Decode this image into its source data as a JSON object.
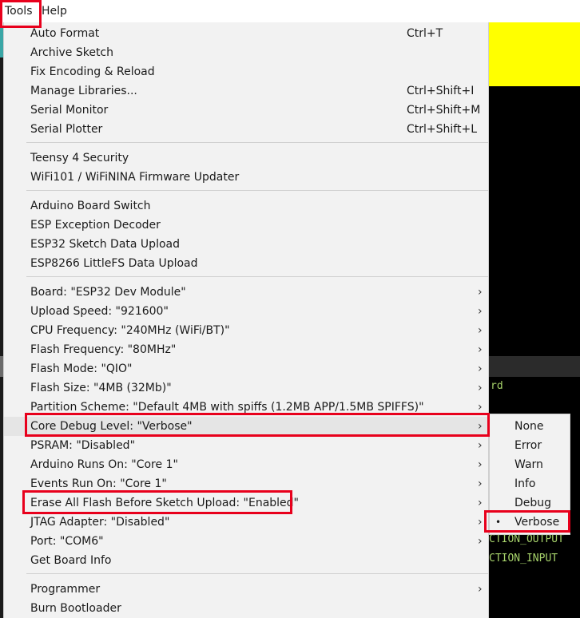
{
  "menubar": {
    "tools": "Tools",
    "help": "Help"
  },
  "console": {
    "line1": "rd",
    "line2": "CTION_OUTPUT",
    "line3": "CTION_INPUT"
  },
  "tools_menu": {
    "g1": [
      {
        "label": "Auto Format",
        "shortcut": "Ctrl+T"
      },
      {
        "label": "Archive Sketch"
      },
      {
        "label": "Fix Encoding & Reload"
      },
      {
        "label": "Manage Libraries...",
        "shortcut": "Ctrl+Shift+I"
      },
      {
        "label": "Serial Monitor",
        "shortcut": "Ctrl+Shift+M"
      },
      {
        "label": "Serial Plotter",
        "shortcut": "Ctrl+Shift+L"
      }
    ],
    "g2": [
      {
        "label": "Teensy 4 Security"
      },
      {
        "label": "WiFi101 / WiFiNINA Firmware Updater"
      }
    ],
    "g3": [
      {
        "label": "Arduino Board Switch"
      },
      {
        "label": "ESP Exception Decoder"
      },
      {
        "label": "ESP32 Sketch Data Upload"
      },
      {
        "label": "ESP8266 LittleFS Data Upload"
      }
    ],
    "g4": [
      {
        "label": "Board: \"ESP32 Dev Module\""
      },
      {
        "label": "Upload Speed: \"921600\""
      },
      {
        "label": "CPU Frequency: \"240MHz (WiFi/BT)\""
      },
      {
        "label": "Flash Frequency: \"80MHz\""
      },
      {
        "label": "Flash Mode: \"QIO\""
      },
      {
        "label": "Flash Size: \"4MB (32Mb)\""
      },
      {
        "label": "Partition Scheme: \"Default 4MB with spiffs (1.2MB APP/1.5MB SPIFFS)\""
      },
      {
        "label": "Core Debug Level: \"Verbose\""
      },
      {
        "label": "PSRAM: \"Disabled\""
      },
      {
        "label": "Arduino Runs On: \"Core 1\""
      },
      {
        "label": "Events Run On: \"Core 1\""
      },
      {
        "label": "Erase All Flash Before Sketch Upload: \"Enabled\""
      },
      {
        "label": "JTAG Adapter: \"Disabled\""
      },
      {
        "label": "Port: \"COM6\""
      },
      {
        "label": "Get Board Info"
      }
    ],
    "g5": [
      {
        "label": "Programmer"
      },
      {
        "label": "Burn Bootloader"
      }
    ]
  },
  "submenu": {
    "bullet": "•",
    "items": [
      "None",
      "Error",
      "Warn",
      "Info",
      "Debug",
      "Verbose"
    ],
    "selected": "Verbose"
  },
  "arrow_glyph": "›",
  "colors": {
    "highlight_box": "#e8001c",
    "menu_bg": "#f2f2f2",
    "hover_bg": "#e5e5e5"
  }
}
